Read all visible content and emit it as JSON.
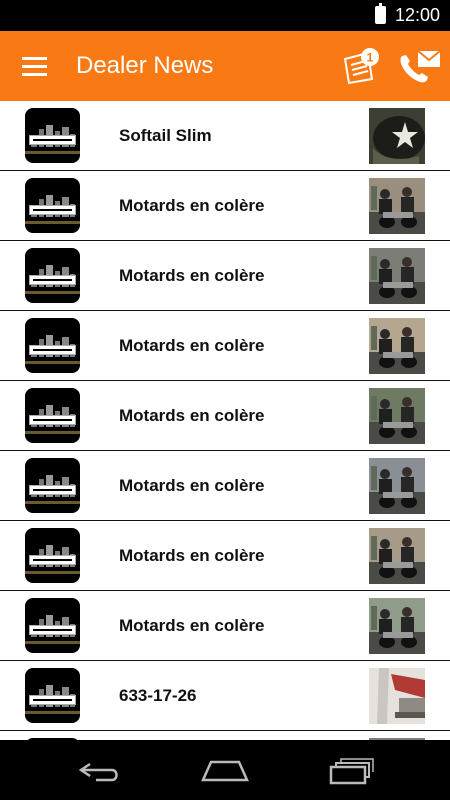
{
  "status_bar": {
    "time": "12:00"
  },
  "app_bar": {
    "title": "Dealer News",
    "notification_count": "1",
    "accent": "#f97a14"
  },
  "news_items": [
    {
      "title": "Softail Slim",
      "thumb": "helmet"
    },
    {
      "title": "Motards en colère",
      "thumb": "riders"
    },
    {
      "title": "Motards en colère",
      "thumb": "riders"
    },
    {
      "title": "Motards en colère",
      "thumb": "riders"
    },
    {
      "title": "Motards en colère",
      "thumb": "riders"
    },
    {
      "title": "Motards en colère",
      "thumb": "riders"
    },
    {
      "title": "Motards en colère",
      "thumb": "riders"
    },
    {
      "title": "Motards en colère",
      "thumb": "riders"
    },
    {
      "title": "633-17-26",
      "thumb": "bike-part"
    },
    {
      "title": "",
      "thumb": "riders"
    }
  ],
  "nav": {
    "back": "back-icon",
    "home": "home-icon",
    "recents": "recents-icon"
  }
}
